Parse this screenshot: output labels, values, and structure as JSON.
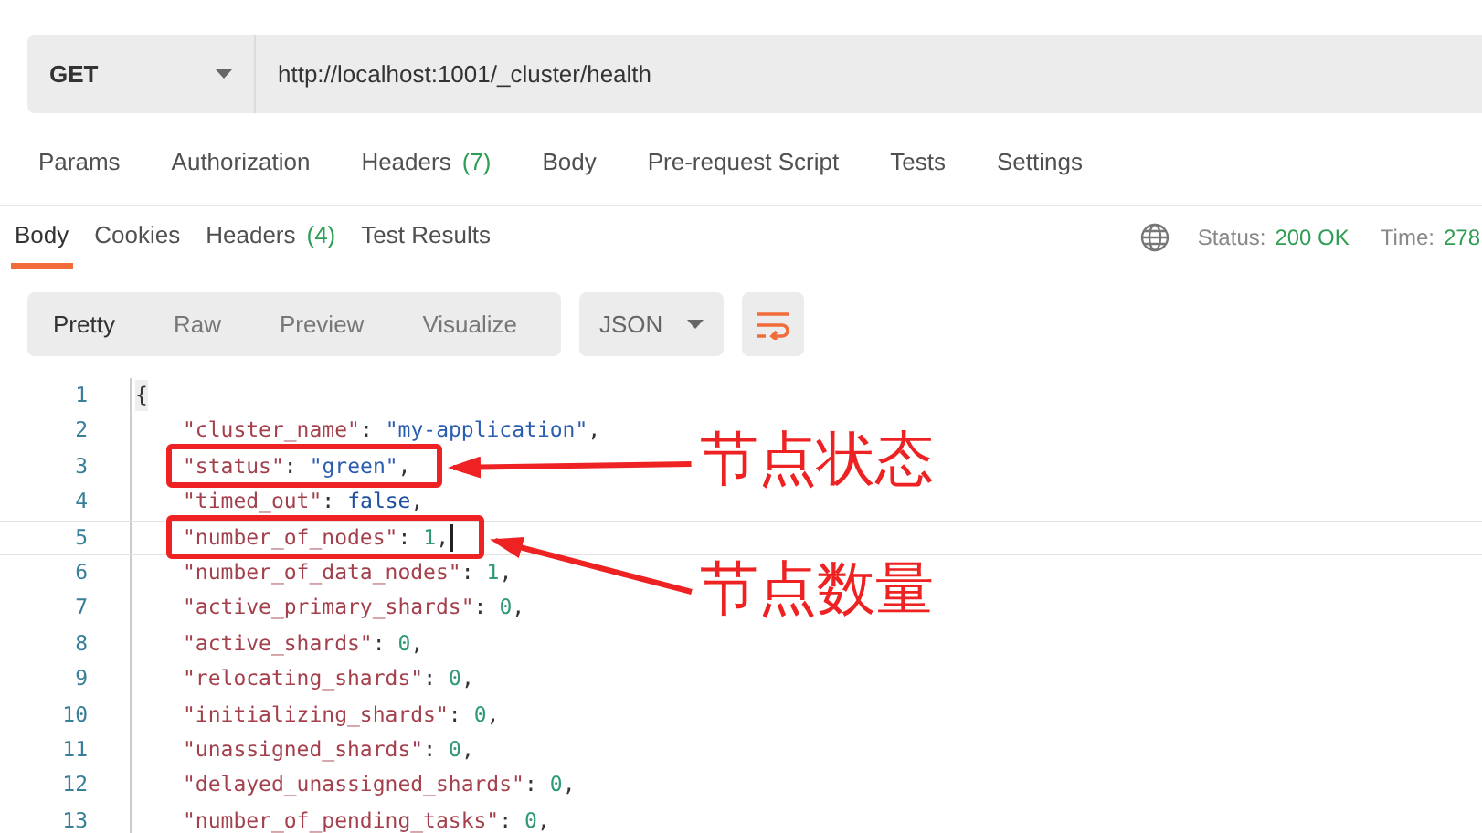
{
  "request": {
    "method": "GET",
    "url": "http://localhost:1001/_cluster/health"
  },
  "request_tabs": [
    {
      "label": "Params",
      "selected": false
    },
    {
      "label": "Authorization",
      "selected": false
    },
    {
      "label": "Headers",
      "count": "(7)",
      "selected": false
    },
    {
      "label": "Body",
      "selected": false
    },
    {
      "label": "Pre-request Script",
      "selected": false
    },
    {
      "label": "Tests",
      "selected": false
    },
    {
      "label": "Settings",
      "selected": false
    }
  ],
  "response_tabs": [
    {
      "label": "Body",
      "selected": true
    },
    {
      "label": "Cookies",
      "selected": false
    },
    {
      "label": "Headers",
      "count": "(4)",
      "selected": false
    },
    {
      "label": "Test Results",
      "selected": false
    }
  ],
  "status": {
    "status_label": "Status:",
    "status_value": "200 OK",
    "time_label": "Time:",
    "time_value": "278"
  },
  "view_modes": [
    {
      "label": "Pretty",
      "selected": true
    },
    {
      "label": "Raw",
      "selected": false
    },
    {
      "label": "Preview",
      "selected": false
    },
    {
      "label": "Visualize",
      "selected": false
    }
  ],
  "format": "JSON",
  "code_lines": [
    {
      "number": "1",
      "kind": "brace",
      "text": "{"
    },
    {
      "number": "2",
      "kind": "pair",
      "key": "\"cluster_name\"",
      "colon": ":",
      "value": "\"my-application\"",
      "comma": ",",
      "color": "#2a5db0"
    },
    {
      "number": "3",
      "kind": "pair",
      "key": "\"status\"",
      "colon": ":",
      "value": "\"green\"",
      "comma": ",",
      "color": "#2a5db0",
      "annotation": "节点状态"
    },
    {
      "number": "4",
      "kind": "pair",
      "key": "\"timed_out\"",
      "colon": ":",
      "value": "false",
      "comma": ",",
      "color": "#1c4fa0"
    },
    {
      "number": "5",
      "kind": "pair",
      "key": "\"number_of_nodes\"",
      "colon": ":",
      "value": "1",
      "comma": ",",
      "color": "#2f9a75",
      "current": true,
      "annotation": "节点数量"
    },
    {
      "number": "6",
      "kind": "pair",
      "key": "\"number_of_data_nodes\"",
      "colon": ":",
      "value": "1",
      "comma": ",",
      "color": "#2f9a75"
    },
    {
      "number": "7",
      "kind": "pair",
      "key": "\"active_primary_shards\"",
      "colon": ":",
      "value": "0",
      "comma": ",",
      "color": "#2f9a75"
    },
    {
      "number": "8",
      "kind": "pair",
      "key": "\"active_shards\"",
      "colon": ":",
      "value": "0",
      "comma": ",",
      "color": "#2f9a75"
    },
    {
      "number": "9",
      "kind": "pair",
      "key": "\"relocating_shards\"",
      "colon": ":",
      "value": "0",
      "comma": ",",
      "color": "#2f9a75"
    },
    {
      "number": "10",
      "kind": "pair",
      "key": "\"initializing_shards\"",
      "colon": ":",
      "value": "0",
      "comma": ",",
      "color": "#2f9a75"
    },
    {
      "number": "11",
      "kind": "pair",
      "key": "\"unassigned_shards\"",
      "colon": ":",
      "value": "0",
      "comma": ",",
      "color": "#2f9a75"
    },
    {
      "number": "12",
      "kind": "pair",
      "key": "\"delayed_unassigned_shards\"",
      "colon": ":",
      "value": "0",
      "comma": ",",
      "color": "#2f9a75"
    },
    {
      "number": "13",
      "kind": "pair",
      "key": "\"number_of_pending_tasks\"",
      "colon": ":",
      "value": "0",
      "comma": ",",
      "color": "#2f9a75"
    }
  ]
}
